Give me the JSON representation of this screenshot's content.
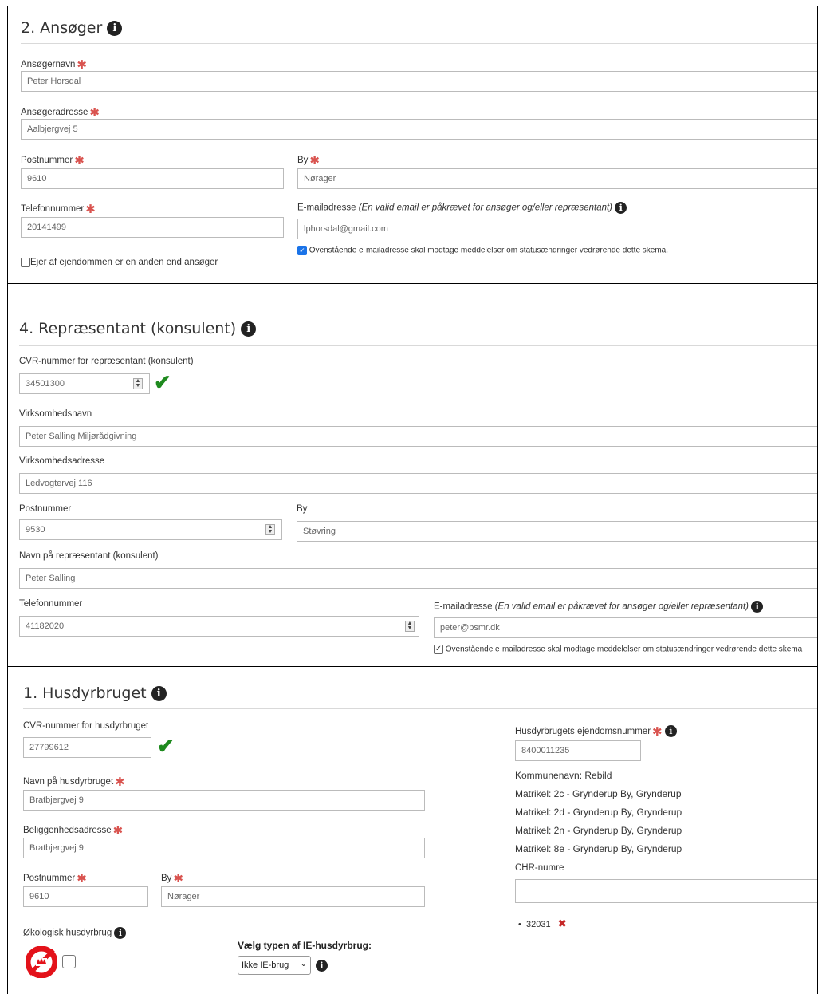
{
  "section1": {
    "title": "2. Ansøger",
    "applicant_name_label": "Ansøgernavn",
    "applicant_name_value": "Peter Horsdal",
    "applicant_address_label": "Ansøgeradresse",
    "applicant_address_value": "Aalbjergvej 5",
    "postal_label": "Postnummer",
    "postal_value": "9610",
    "city_label": "By",
    "city_value": "Nørager",
    "phone_label": "Telefonnummer",
    "phone_value": "20141499",
    "email_label": "E-mailadresse",
    "email_note": "(En valid email er påkrævet for ansøger og/eller repræsentant)",
    "email_value": "lphorsdal@gmail.com",
    "notify_label": "Ovenstående e-mailadresse skal modtage meddelelser om statusændringer vedrørende dette skema.",
    "owner_label": "Ejer af ejendommen er en anden end ansøger"
  },
  "section2": {
    "title": "4. Repræsentant (konsulent)",
    "cvr_label": "CVR-nummer for repræsentant (konsulent)",
    "cvr_value": "34501300",
    "company_name_label": "Virksomhedsnavn",
    "company_name_value": "Peter Salling Miljørådgivning",
    "company_address_label": "Virksomhedsadresse",
    "company_address_value": "Ledvogtervej 116",
    "postal_label": "Postnummer",
    "postal_value": "9530",
    "city_label": "By",
    "city_value": "Støvring",
    "rep_name_label": "Navn på repræsentant (konsulent)",
    "rep_name_value": "Peter Salling",
    "phone_label": "Telefonnummer",
    "phone_value": "41182020",
    "email_label": "E-mailadresse",
    "email_note": "(En valid email er påkrævet for ansøger og/eller repræsentant)",
    "email_value": "peter@psmr.dk",
    "notify_label": "Ovenstående e-mailadresse skal modtage meddelelser om statusændringer vedrørende dette skema"
  },
  "section3": {
    "title": "1. Husdyrbruget",
    "cvr_label": "CVR-nummer for husdyrbruget",
    "cvr_value": "27799612",
    "farm_name_label": "Navn på husdyrbruget",
    "farm_name_value": "Bratbjergvej 9",
    "location_label": "Beliggenhedsadresse",
    "location_value": "Bratbjergvej 9",
    "postal_label": "Postnummer",
    "postal_value": "9610",
    "city_label": "By",
    "city_value": "Nørager",
    "organic_label": "Økologisk husdyrbrug",
    "ie_type_label": "Vælg typen af IE-husdyrbrug:",
    "ie_type_value": "Ikke IE-brug",
    "property_label": "Husdyrbrugets ejendomsnummer",
    "property_value": "8400011235",
    "municipality": "Kommunenavn: Rebild",
    "cadastres": [
      "Matrikel: 2c - Grynderup By, Grynderup",
      "Matrikel: 2d - Grynderup By, Grynderup",
      "Matrikel: 2n - Grynderup By, Grynderup",
      "Matrikel: 8e - Grynderup By, Grynderup"
    ],
    "chr_label": "CHR-numre",
    "chr_value": "",
    "chr_items": [
      "32031"
    ]
  },
  "colors": {
    "required": "#d9534f",
    "valid": "#1e8a1e",
    "remove": "#c62828",
    "organic_logo": "#e3121a"
  },
  "icons": {
    "info": "info-circle-icon",
    "valid": "check-icon",
    "remove": "x-icon",
    "organic": "oe-logo-icon",
    "required": "asterisk-icon"
  }
}
